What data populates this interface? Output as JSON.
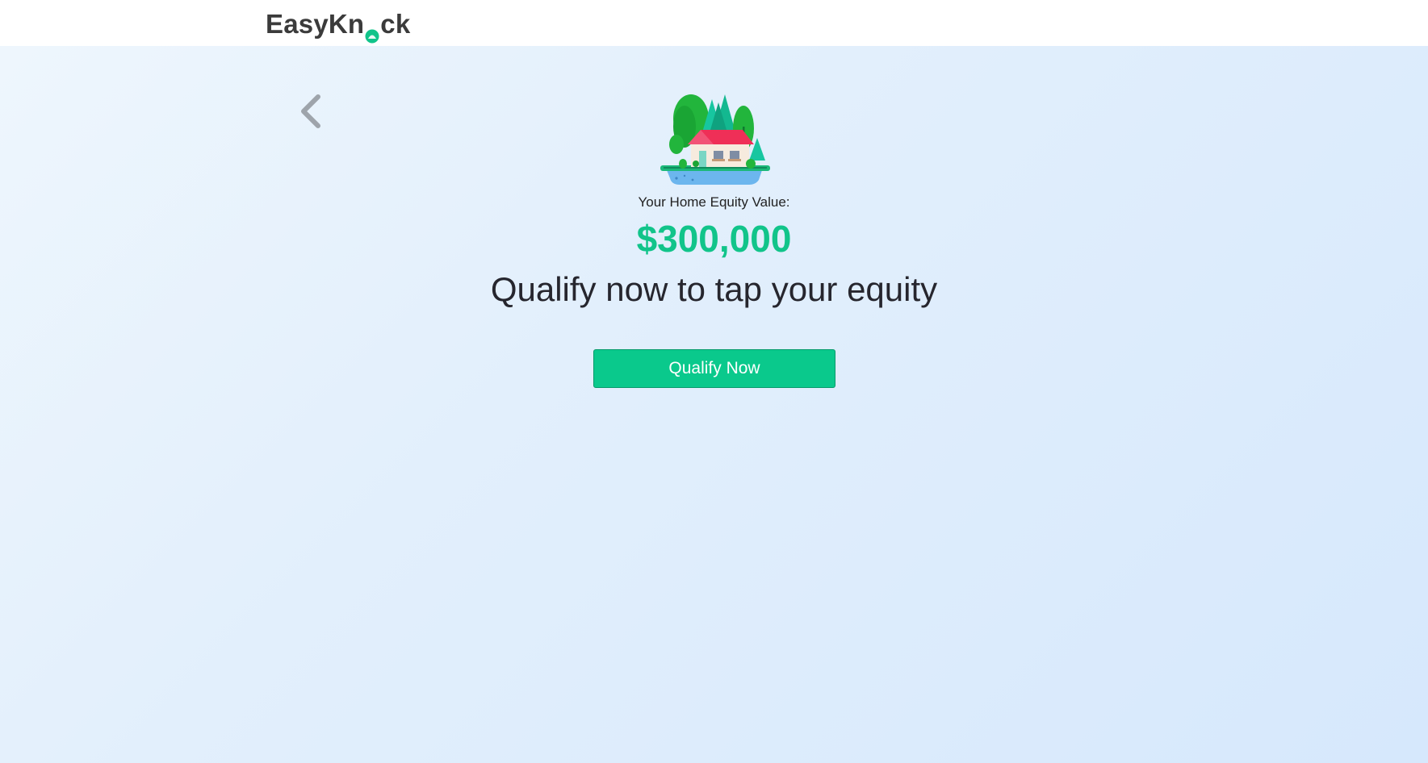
{
  "header": {
    "logo_prefix": "EasyKn",
    "logo_suffix": "ck"
  },
  "nav": {
    "back_icon": "chevron-left-icon"
  },
  "hero": {
    "illustration": "house-with-trees-illustration",
    "equity_label": "Your Home Equity Value:",
    "equity_value": "$300,000",
    "headline": "Qualify now to tap your equity",
    "cta_label": "Qualify Now"
  },
  "colors": {
    "brand_green": "#0ac98c",
    "value_green": "#11c48a",
    "text_dark": "#26262e",
    "background_start": "#eef6fd",
    "background_end": "#d6e8fc"
  }
}
